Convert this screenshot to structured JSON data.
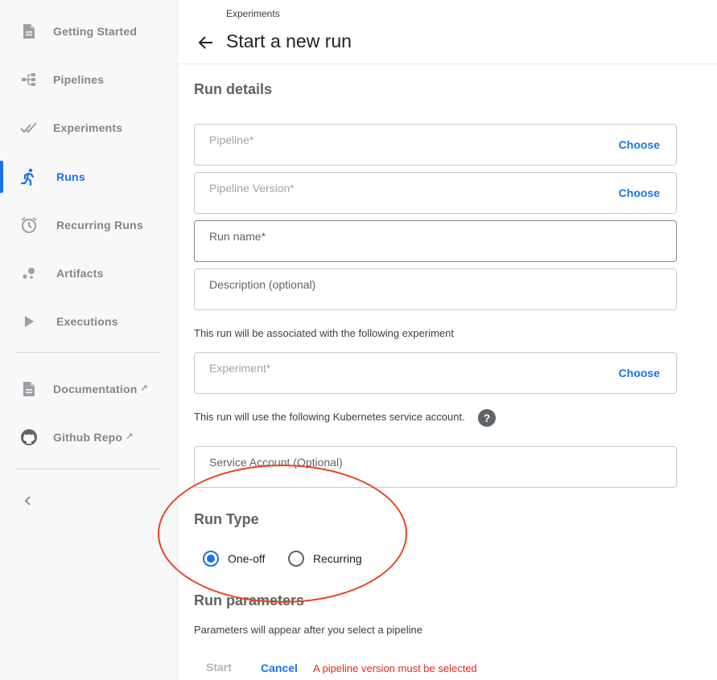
{
  "sidebar": {
    "items": [
      {
        "label": "Getting Started",
        "icon": "document-icon"
      },
      {
        "label": "Pipelines",
        "icon": "pipeline-icon"
      },
      {
        "label": "Experiments",
        "icon": "experiments-icon"
      },
      {
        "label": "Runs",
        "icon": "runner-icon",
        "active": true
      },
      {
        "label": "Recurring Runs",
        "icon": "alarm-clock-icon"
      },
      {
        "label": "Artifacts",
        "icon": "artifacts-icon"
      },
      {
        "label": "Executions",
        "icon": "play-icon"
      }
    ],
    "links": [
      {
        "label": "Documentation",
        "icon": "document-icon"
      },
      {
        "label": "Github Repo",
        "icon": "github-icon"
      }
    ],
    "accent_color": "#1a73e8"
  },
  "header": {
    "breadcrumb": "Experiments",
    "title": "Start a new run"
  },
  "run_details": {
    "title": "Run details",
    "pipeline": {
      "label": "Pipeline",
      "required": "*",
      "action": "Choose"
    },
    "pipeline_version": {
      "label": "Pipeline Version",
      "required": "*",
      "action": "Choose"
    },
    "run_name": {
      "label": "Run name",
      "required": "*",
      "value": ""
    },
    "description": {
      "label": "Description (optional)",
      "value": ""
    },
    "experiment_note": "This run will be associated with the following experiment",
    "experiment": {
      "label": "Experiment",
      "required": "*",
      "action": "Choose"
    },
    "service_account_note": "This run will use the following Kubernetes service account.",
    "help_glyph": "?",
    "service_account": {
      "label": "Service Account (Optional)",
      "value": ""
    }
  },
  "run_type": {
    "title": "Run Type",
    "options": [
      {
        "label": "One-off",
        "selected": true
      },
      {
        "label": "Recurring",
        "selected": false
      }
    ]
  },
  "run_parameters": {
    "title": "Run parameters",
    "note": "Parameters will appear after you select a pipeline"
  },
  "actions": {
    "start": "Start",
    "cancel": "Cancel",
    "error": "A pipeline version must be selected"
  },
  "annotation_color": "#e8431f"
}
